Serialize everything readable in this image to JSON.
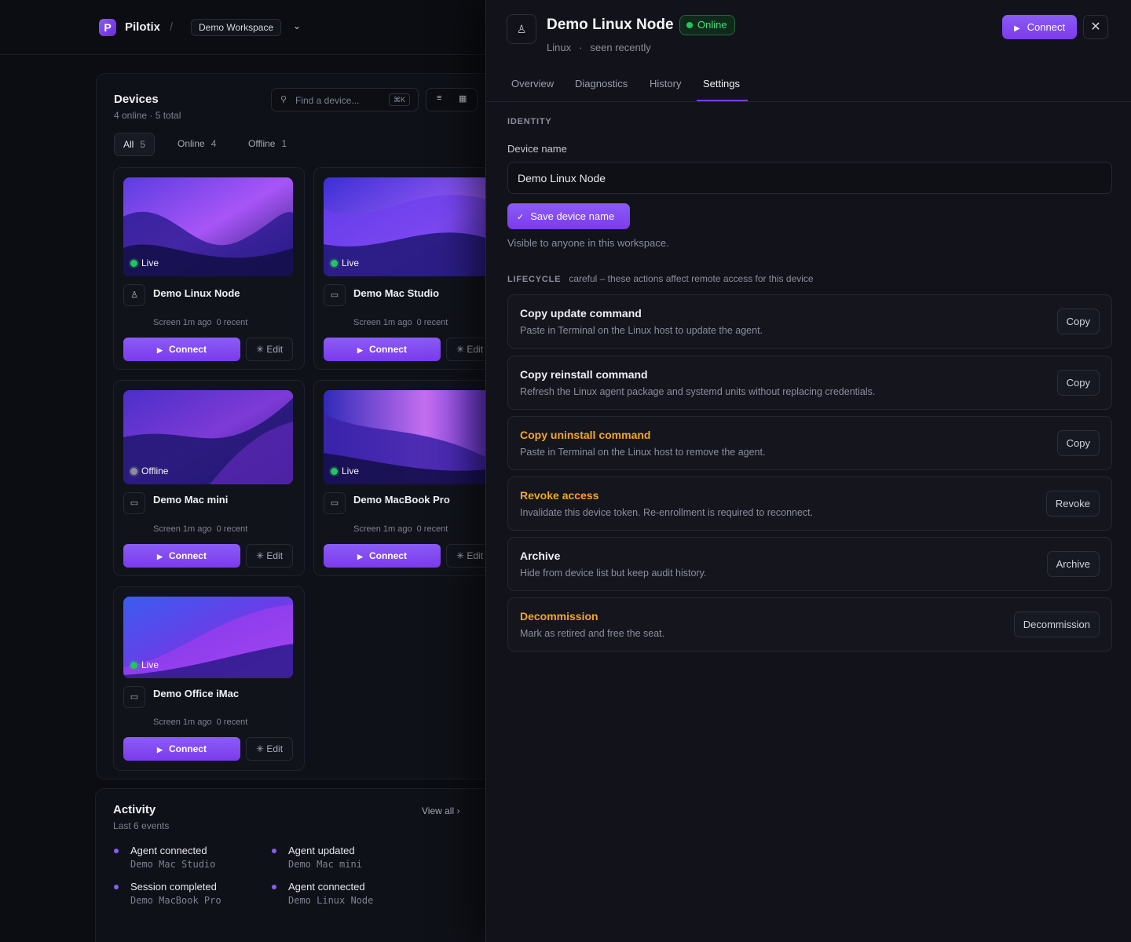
{
  "app": {
    "brand": "Pilotix",
    "workspace": "Demo Workspace"
  },
  "devices": {
    "title": "Devices",
    "summary": "4 online · 5 total",
    "search_placeholder": "Find a device...",
    "search_shortcut": "⌘K",
    "filters": [
      {
        "label": "All",
        "count": "5"
      },
      {
        "label": "Online",
        "count": "4"
      },
      {
        "label": "Offline",
        "count": "1"
      }
    ],
    "connect_label": "Connect",
    "edit_label": "Edit",
    "cards": [
      {
        "name": "Demo Linux Node",
        "status": "Live",
        "screen": "Screen 1m ago",
        "recent": "0 recent",
        "icon": "linux-icon"
      },
      {
        "name": "Demo Mac Studio",
        "status": "Live",
        "screen": "Screen 1m ago",
        "recent": "0 recent",
        "icon": "monitor-icon"
      },
      {
        "name": "Demo Mac mini",
        "status": "Offline",
        "screen": "Screen 1m ago",
        "recent": "0 recent",
        "icon": "monitor-icon"
      },
      {
        "name": "Demo MacBook Pro",
        "status": "Live",
        "screen": "Screen 1m ago",
        "recent": "0 recent",
        "icon": "monitor-icon"
      },
      {
        "name": "Demo Office iMac",
        "status": "Live",
        "screen": "Screen 1m ago",
        "recent": "0 recent",
        "icon": "monitor-icon"
      }
    ]
  },
  "activity": {
    "title": "Activity",
    "subtitle": "Last 6 events",
    "view_all": "View all",
    "events": [
      {
        "title": "Agent connected",
        "device": "Demo Mac Studio"
      },
      {
        "title": "Agent updated",
        "device": "Demo Mac mini"
      },
      {
        "title": "Session completed",
        "device": "Demo MacBook Pro"
      },
      {
        "title": "Agent connected",
        "device": "Demo Linux Node"
      }
    ]
  },
  "drawer": {
    "title": "Demo Linux Node",
    "status": "Online",
    "os": "Linux",
    "seen": "seen recently",
    "connect_label": "Connect",
    "tabs": [
      "Overview",
      "Diagnostics",
      "History",
      "Settings"
    ],
    "active_tab": "Settings",
    "identity": {
      "section": "IDENTITY",
      "field_label": "Device name",
      "value": "Demo Linux Node",
      "save_label": "Save device name",
      "help": "Visible to anyone in this workspace."
    },
    "lifecycle": {
      "section": "LIFECYCLE",
      "note": "careful – these actions affect remote access for this device",
      "actions": [
        {
          "title": "Copy update command",
          "desc": "Paste in Terminal on the Linux host to update the agent.",
          "button": "Copy",
          "warn": false
        },
        {
          "title": "Copy reinstall command",
          "desc": "Refresh the Linux agent package and systemd units without replacing credentials.",
          "button": "Copy",
          "warn": false
        },
        {
          "title": "Copy uninstall command",
          "desc": "Paste in Terminal on the Linux host to remove the agent.",
          "button": "Copy",
          "warn": true
        },
        {
          "title": "Revoke access",
          "desc": "Invalidate this device token. Re-enrollment is required to reconnect.",
          "button": "Revoke",
          "warn": true
        },
        {
          "title": "Archive",
          "desc": "Hide from device list but keep audit history.",
          "button": "Archive",
          "warn": false
        },
        {
          "title": "Decommission",
          "desc": "Mark as retired and free the seat.",
          "button": "Decommission",
          "warn": true
        }
      ]
    }
  },
  "colors": {
    "accent": "#7c3aed",
    "online": "#22c55e",
    "warning": "#f5a623"
  }
}
